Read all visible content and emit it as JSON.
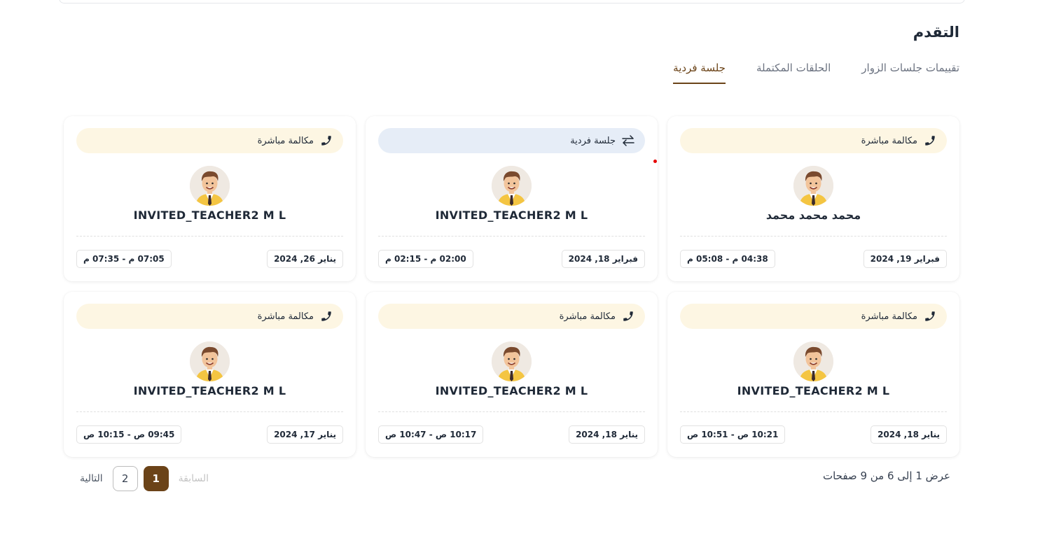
{
  "page": {
    "title": "التقدم"
  },
  "tabs": [
    {
      "label": "تقييمات جلسات الزوار",
      "active": false
    },
    {
      "label": "الحلقات المكتملة",
      "active": false
    },
    {
      "label": "جلسة فردية",
      "active": true
    }
  ],
  "cards": [
    {
      "type": "مكالمة مباشرة",
      "type_icon": "phone-icon",
      "name": "محمد محمد محمد",
      "date": "فبراير 19, 2024",
      "time": "04:38 م - 05:08 م"
    },
    {
      "type": "جلسة فردية",
      "type_icon": "swap-arrows-icon",
      "name": "INVITED_TEACHER2 M L",
      "date": "فبراير 18, 2024",
      "time": "02:00 م - 02:15 م"
    },
    {
      "type": "مكالمة مباشرة",
      "type_icon": "phone-icon",
      "name": "INVITED_TEACHER2 M L",
      "date": "يناير 26, 2024",
      "time": "07:05 م - 07:35 م"
    },
    {
      "type": "مكالمة مباشرة",
      "type_icon": "phone-icon",
      "name": "INVITED_TEACHER2 M L",
      "date": "يناير 18, 2024",
      "time": "10:21 ص - 10:51 ص"
    },
    {
      "type": "مكالمة مباشرة",
      "type_icon": "phone-icon",
      "name": "INVITED_TEACHER2 M L",
      "date": "يناير 18, 2024",
      "time": "10:17 ص - 10:47 ص"
    },
    {
      "type": "مكالمة مباشرة",
      "type_icon": "phone-icon",
      "name": "INVITED_TEACHER2 M L",
      "date": "يناير 17, 2024",
      "time": "09:45 ص - 10:15 ص"
    }
  ],
  "pagination": {
    "summary": "عرض 1 إلى 6 من 9 صفحات",
    "prev_label": "السابقة",
    "next_label": "التالية",
    "pages": [
      "1",
      "2"
    ],
    "current": "1"
  },
  "colors": {
    "accent": "#6b4318",
    "call_pill": "#fdf6e3",
    "individual_pill": "#e6edf7",
    "indicator": "#e60000"
  }
}
